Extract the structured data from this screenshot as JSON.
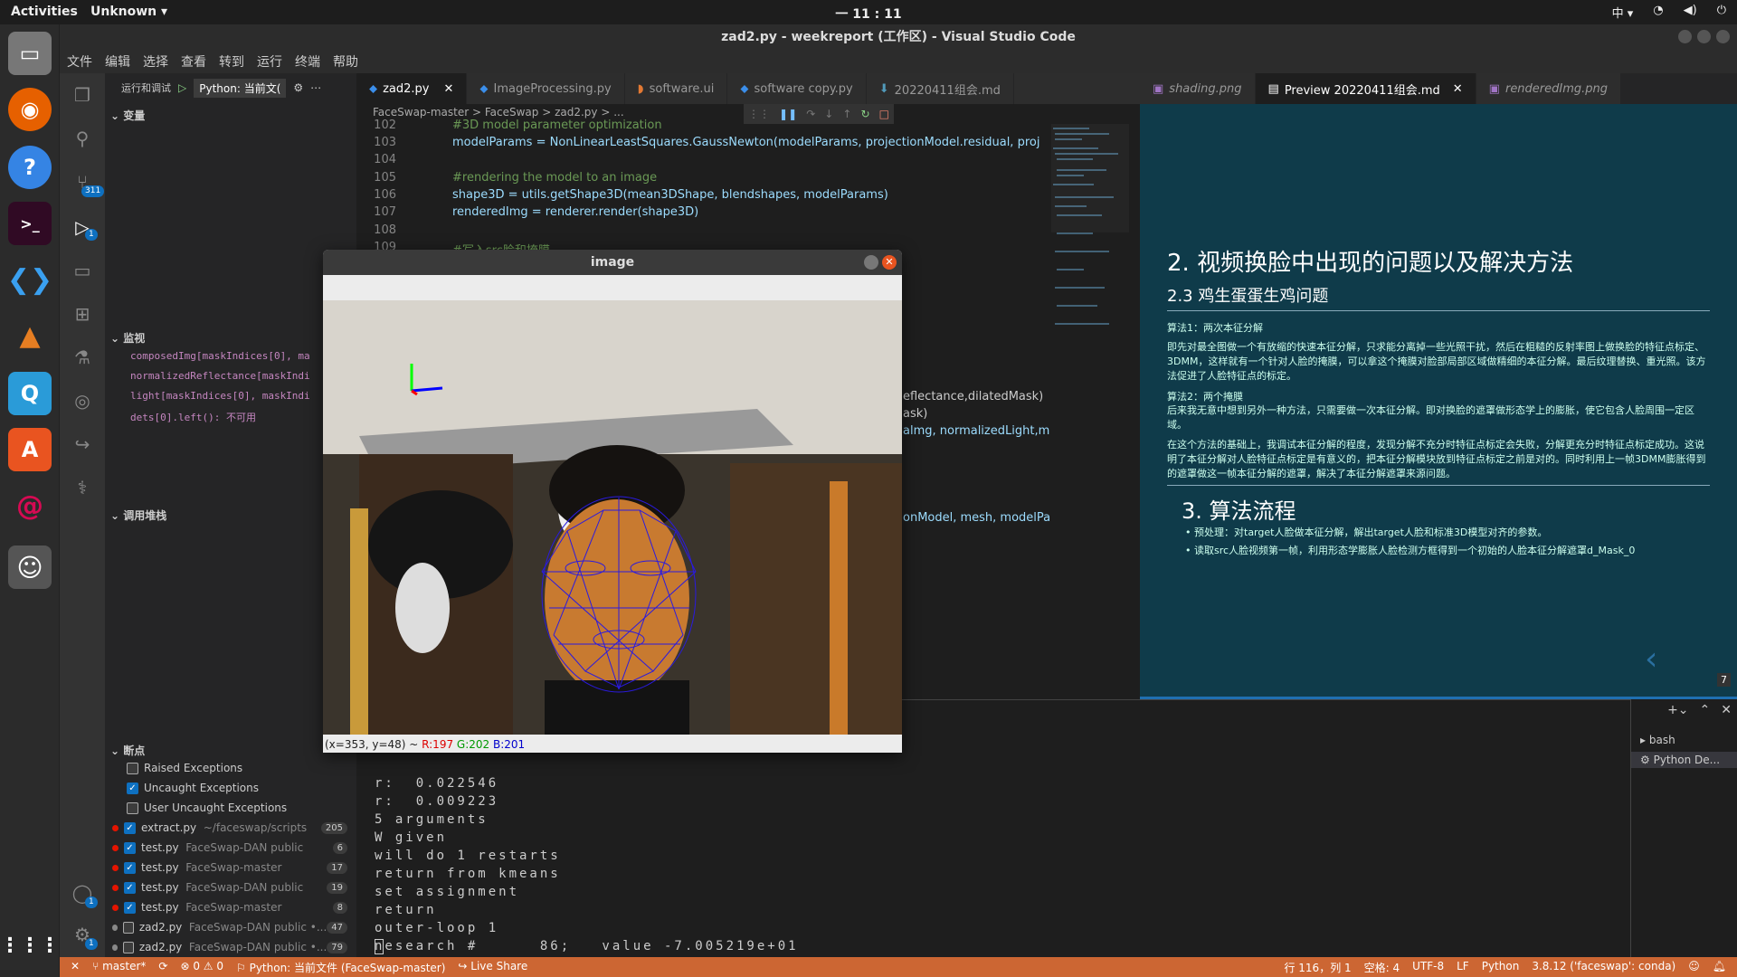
{
  "topbar": {
    "activities": "Activities",
    "app": "Unknown ▾",
    "clock": "一 11 : 11",
    "ime": "中 ▾"
  },
  "window": {
    "title": "zad2.py - weekreport (工作区) - Visual Studio Code"
  },
  "menu": [
    "文件",
    "编辑",
    "选择",
    "查看",
    "转到",
    "运行",
    "终端",
    "帮助"
  ],
  "activity": {
    "scm_badge": "311",
    "debug_badge": "1",
    "account_badge": "1",
    "settings_badge": "1"
  },
  "sidebar": {
    "run_label": "运行和调试",
    "config": "Python: 当前文(",
    "variables": "变量",
    "watch": "监视",
    "watch_items": [
      "composedImg[maskIndices[0], ma",
      "normalizedReflectance[maskIndi",
      "light[maskIndices[0], maskIndi",
      "dets[0].left(): 不可用"
    ],
    "callstack": "调用堆栈",
    "breakpoints": "断点",
    "bp_options": [
      {
        "label": "Raised Exceptions",
        "checked": false
      },
      {
        "label": "Uncaught Exceptions",
        "checked": true
      },
      {
        "label": "User Uncaught Exceptions",
        "checked": false
      }
    ],
    "bp_files": [
      {
        "file": "extract.py",
        "path": "~/faceswap/scripts",
        "line": "205",
        "active": true
      },
      {
        "file": "test.py",
        "path": "FaceSwap-DAN public",
        "line": "6",
        "active": true
      },
      {
        "file": "test.py",
        "path": "FaceSwap-master",
        "line": "17",
        "active": true
      },
      {
        "file": "test.py",
        "path": "FaceSwap-DAN public",
        "line": "19",
        "active": true
      },
      {
        "file": "test.py",
        "path": "FaceSwap-master",
        "line": "8",
        "active": true
      },
      {
        "file": "zad2.py",
        "path": "FaceSwap-DAN public •...",
        "line": "47",
        "active": false
      },
      {
        "file": "zad2.py",
        "path": "FaceSwap-DAN public •...",
        "line": "79",
        "active": false
      }
    ]
  },
  "tabs": [
    "zad2.py",
    "ImageProcessing.py",
    "software.ui",
    "software copy.py",
    "20220411组会.md"
  ],
  "breadcrumb": "FaceSwap-master  >  FaceSwap  >  zad2.py  >  ...",
  "code_lines": [
    {
      "n": "102",
      "t": "#3D model parameter optimization",
      "c": "#6a9955"
    },
    {
      "n": "103",
      "t": "modelParams = NonLinearLeastSquares.GaussNewton(modelParams, projectionModel.residual, proj",
      "c": "#9cdcfe"
    },
    {
      "n": "104",
      "t": "",
      "c": "#ccc"
    },
    {
      "n": "105",
      "t": "#rendering the model to an image",
      "c": "#6a9955"
    },
    {
      "n": "106",
      "t": "shape3D = utils.getShape3D(mean3DShape, blendshapes, modelParams)",
      "c": "#9cdcfe"
    },
    {
      "n": "107",
      "t": "renderedImg = renderer.render(shape3D)",
      "c": "#9cdcfe"
    },
    {
      "n": "108",
      "t": "",
      "c": "#ccc"
    },
    {
      "n": "109",
      "t": "#写入src脸和掩膜",
      "c": "#6a9955"
    }
  ],
  "code_fragments": [
    "eflectance,dilatedMask)",
    "ask)",
    "almg, normalizedLight,m",
    "onModel, mesh, modelPa"
  ],
  "right_tabs": [
    "shading.png",
    "Preview 20220411组会.md",
    "renderedImg.png"
  ],
  "slide": {
    "h1": "2. 视频换脸中出现的问题以及解决方法",
    "h2": "2.3 鸡生蛋蛋生鸡问题",
    "p1": "算法1：两次本征分解",
    "p2": "即先对最全图做一个有放缩的快速本征分解，只求能分离掉一些光照干扰，然后在粗糙的反射率图上做换脸的特征点标定、3DMM，这样就有一个针对人脸的掩膜，可以拿这个掩膜对脸部局部区域做精细的本征分解。最后纹理替换、重光照。该方法促进了人脸特征点的标定。",
    "p3": "算法2：两个掩膜",
    "p4": "后来我无意中想到另外一种方法，只需要做一次本征分解。即对换脸的遮罩做形态学上的膨胀，使它包含人脸周围一定区域。",
    "p5": "在这个方法的基础上，我调试本征分解的程度，发现分解不充分时特征点标定会失败，分解更充分时特征点标定成功。这说明了本征分解对人脸特征点标定是有意义的，把本征分解模块放到特征点标定之前是对的。同时利用上一帧3DMM膨胀得到的遮罩做这一帧本征分解的遮罩，解决了本征分解遮罩来源问题。",
    "h3": "3. 算法流程",
    "b1": "预处理：对target人脸做本征分解，解出target人脸和标准3D模型对齐的参数。",
    "b2": "读取src人脸视频第一帧，利用形态学膨胀人脸检测方框得到一个初始的人脸本征分解遮罩d_Mask_0",
    "page": "7"
  },
  "terminal": {
    "lines": [
      "r:  0.022546",
      "r:  0.009223",
      "5 arguments",
      "W given",
      "will do 1 restarts",
      "return from kmeans",
      "set assignment",
      "return",
      "outer-loop 1",
      "nesearch #      86;   value -7.005219e+01"
    ],
    "shells": [
      "bash",
      "Python De..."
    ]
  },
  "imagewin": {
    "title": "image",
    "coords": "(x=353, y=48) ~ ",
    "r": "R:197",
    "g": "G:202",
    "b": "B:201"
  },
  "status": {
    "branch": "master*",
    "errors": "⊗ 0 ⚠ 0",
    "python": "Python: 当前文件 (FaceSwap-master)",
    "liveshare": "Live Share",
    "pos": "行 116，列 1",
    "spaces": "空格: 4",
    "enc": "UTF-8",
    "eol": "LF",
    "lang": "Python",
    "interp": "3.8.12 ('faceswap': conda)"
  }
}
